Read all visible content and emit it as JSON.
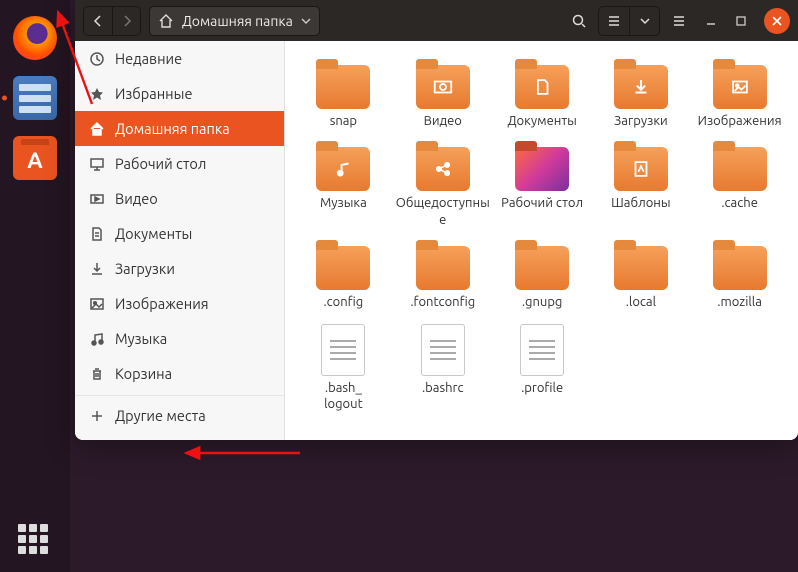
{
  "dock": {
    "items": [
      {
        "id": "firefox",
        "active": false
      },
      {
        "id": "files",
        "active": true
      },
      {
        "id": "software",
        "active": false
      }
    ]
  },
  "window": {
    "path_label": "Домашняя папка"
  },
  "sidebar": {
    "section1": [
      {
        "icon": "clock",
        "label": "Недавние"
      },
      {
        "icon": "star",
        "label": "Избранные"
      },
      {
        "icon": "home",
        "label": "Домашняя папка",
        "selected": true
      },
      {
        "icon": "desktop",
        "label": "Рабочий стол"
      },
      {
        "icon": "video",
        "label": "Видео"
      },
      {
        "icon": "doc",
        "label": "Документы"
      },
      {
        "icon": "download",
        "label": "Загрузки"
      },
      {
        "icon": "image",
        "label": "Изображения"
      },
      {
        "icon": "music",
        "label": "Музыка"
      },
      {
        "icon": "trash",
        "label": "Корзина"
      }
    ],
    "other_places": "Другие места"
  },
  "grid_items": [
    {
      "type": "folder",
      "label": "snap",
      "glyph": ""
    },
    {
      "type": "folder",
      "label": "Видео",
      "glyph": "video"
    },
    {
      "type": "folder",
      "label": "Документы",
      "glyph": "doc"
    },
    {
      "type": "folder",
      "label": "Загрузки",
      "glyph": "download"
    },
    {
      "type": "folder",
      "label": "Изображения",
      "glyph": "image"
    },
    {
      "type": "folder",
      "label": "Музыка",
      "glyph": "music"
    },
    {
      "type": "folder",
      "label": "Общедоступные",
      "glyph": "share"
    },
    {
      "type": "folder-gradient",
      "label": "Рабочий стол",
      "glyph": ""
    },
    {
      "type": "folder",
      "label": "Шаблоны",
      "glyph": "template"
    },
    {
      "type": "folder",
      "label": ".cache",
      "glyph": ""
    },
    {
      "type": "folder",
      "label": ".config",
      "glyph": ""
    },
    {
      "type": "folder",
      "label": ".fontconfig",
      "glyph": ""
    },
    {
      "type": "folder",
      "label": ".gnupg",
      "glyph": ""
    },
    {
      "type": "folder",
      "label": ".local",
      "glyph": ""
    },
    {
      "type": "folder",
      "label": ".mozilla",
      "glyph": ""
    },
    {
      "type": "file",
      "label": ".bash_\nlogout"
    },
    {
      "type": "file",
      "label": ".bashrc"
    },
    {
      "type": "file",
      "label": ".profile"
    }
  ]
}
